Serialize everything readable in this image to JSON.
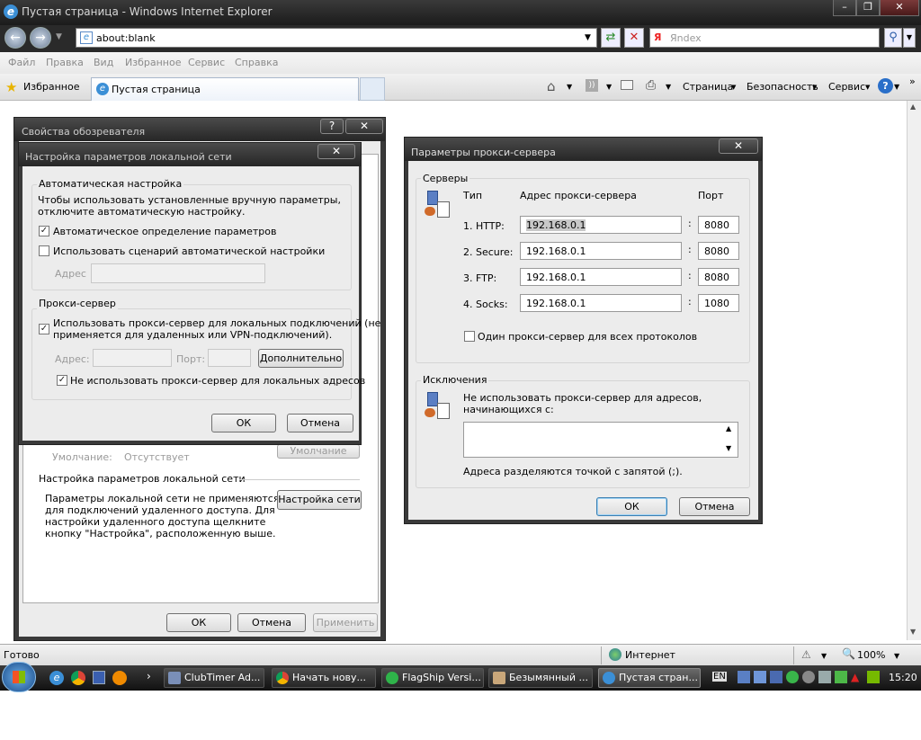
{
  "window": {
    "title": "Пустая страница - Windows Internet Explorer",
    "address": "about:blank",
    "search_placeholder": "Яndex"
  },
  "menu": [
    "Файл",
    "Правка",
    "Вид",
    "Избранное",
    "Сервис",
    "Справка"
  ],
  "toolbar": {
    "favorites": "Избранное",
    "tab_title": "Пустая страница",
    "page": "Страница",
    "security": "Безопасность",
    "tools": "Сервис"
  },
  "status": {
    "text": "Готово",
    "zone": "Интернет",
    "zoom": "100%"
  },
  "taskbar": {
    "tasks": [
      "ClubTimer Ad...",
      "Начать нову...",
      "FlagShip Versi...",
      "Безымянный ...",
      "Пустая стран..."
    ],
    "lang": "EN",
    "clock": "15:20"
  },
  "internet_options": {
    "title": "Свойства обозревателя",
    "default_label": "Умолчание:",
    "default_value": "Отсутствует",
    "default_button": "Умолчание",
    "lan_section": "Настройка параметров локальной сети",
    "lan_note": [
      "Параметры локальной сети не применяются",
      "для подключений удаленного доступа. Для",
      "настройки удаленного доступа щелкните",
      "кнопку \"Настройка\", расположенную выше."
    ],
    "lan_button": "Настройка сети",
    "ok": "ОК",
    "cancel": "Отмена",
    "apply": "Применить"
  },
  "lan_dialog": {
    "title": "Настройка параметров локальной сети",
    "auto_group": "Автоматическая настройка",
    "auto_desc": [
      "Чтобы использовать установленные вручную параметры,",
      "отключите автоматическую настройку."
    ],
    "auto_detect": "Автоматическое определение параметров",
    "auto_detect_checked": true,
    "use_script": "Использовать сценарий автоматической настройки",
    "use_script_checked": false,
    "address_label": "Адрес",
    "proxy_group": "Прокси-сервер",
    "use_proxy": [
      "Использовать прокси-сервер для локальных подключений (не",
      "применяется для удаленных или VPN-подключений)."
    ],
    "use_proxy_checked": true,
    "proxy_address_label": "Адрес:",
    "proxy_port_label": "Порт:",
    "advanced": "Дополнительно",
    "bypass_local": "Не использовать прокси-сервер для локальных адресов",
    "bypass_local_checked": true,
    "ok": "ОК",
    "cancel": "Отмена"
  },
  "proxy_dialog": {
    "title": "Параметры прокси-сервера",
    "servers_group": "Серверы",
    "col_type": "Тип",
    "col_address": "Адрес прокси-сервера",
    "col_port": "Порт",
    "rows": [
      {
        "type": "1. HTTP:",
        "address": "192.168.0.1",
        "port": "8080"
      },
      {
        "type": "2. Secure:",
        "address": "192.168.0.1",
        "port": "8080"
      },
      {
        "type": "3. FTP:",
        "address": "192.168.0.1",
        "port": "8080"
      },
      {
        "type": "4. Socks:",
        "address": "192.168.0.1",
        "port": "1080"
      }
    ],
    "same_proxy": "Один прокси-сервер для всех протоколов",
    "same_proxy_checked": false,
    "exceptions_group": "Исключения",
    "exceptions_desc": [
      "Не использовать прокси-сервер для адресов,",
      "начинающихся с:"
    ],
    "exceptions_value": "",
    "separator_note": "Адреса разделяются точкой с запятой (;).",
    "ok": "ОК",
    "cancel": "Отмена"
  }
}
